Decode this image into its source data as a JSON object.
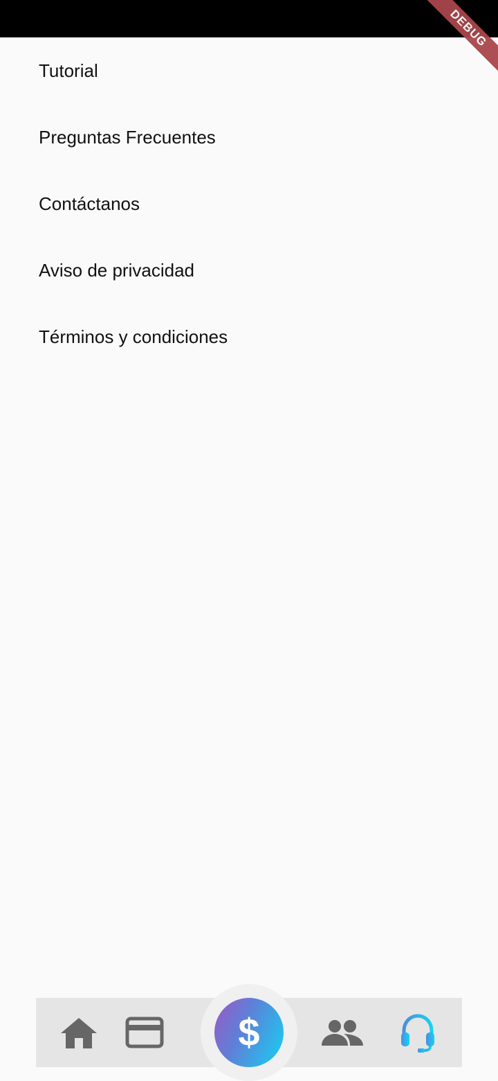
{
  "debug_banner": {
    "label": "DEBUG"
  },
  "menu": {
    "items": [
      {
        "label": "Tutorial"
      },
      {
        "label": "Preguntas Frecuentes"
      },
      {
        "label": "Contáctanos"
      },
      {
        "label": "Aviso de privacidad"
      },
      {
        "label": "Términos y condiciones"
      }
    ]
  },
  "bottom_nav": {
    "items": [
      {
        "icon": "home-icon",
        "color": "#666666"
      },
      {
        "icon": "credit-card-icon",
        "color": "#666666"
      },
      {
        "icon": "dollar-icon",
        "glyph": "$",
        "color": "#ffffff"
      },
      {
        "icon": "people-icon",
        "color": "#666666"
      },
      {
        "icon": "headset-icon",
        "color": "#19c8f0",
        "active": true
      }
    ]
  },
  "colors": {
    "background": "#fafafa",
    "nav_background": "#e5e5e5",
    "inactive_icon": "#666666",
    "active_icon": "#19c8f0",
    "debug_banner": "#a8474c"
  }
}
